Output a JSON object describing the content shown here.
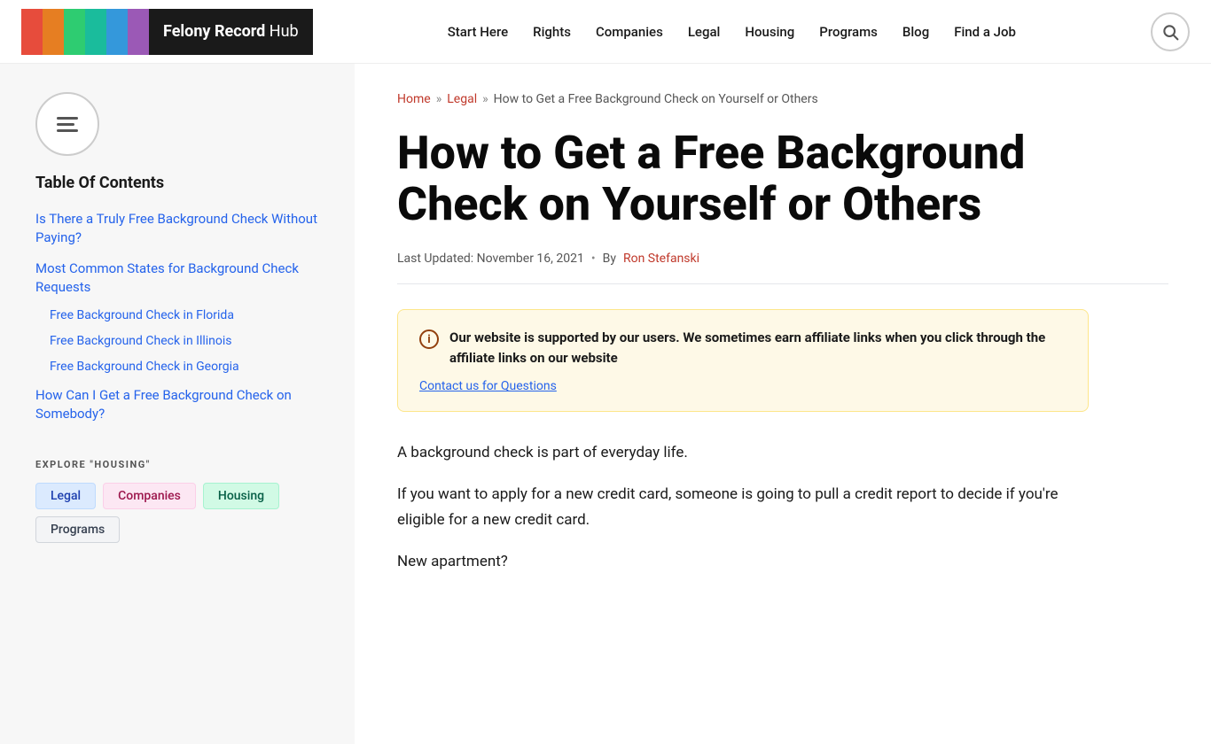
{
  "header": {
    "logo_text_bold": "Felony Record",
    "logo_text_normal": " Hub",
    "nav_items": [
      {
        "label": "Start Here",
        "href": "#"
      },
      {
        "label": "Rights",
        "href": "#"
      },
      {
        "label": "Companies",
        "href": "#"
      },
      {
        "label": "Legal",
        "href": "#"
      },
      {
        "label": "Housing",
        "href": "#"
      },
      {
        "label": "Programs",
        "href": "#"
      },
      {
        "label": "Blog",
        "href": "#"
      },
      {
        "label": "Find a Job",
        "href": "#"
      }
    ],
    "search_label": "🔍"
  },
  "sidebar": {
    "toc_title": "Table Of Contents",
    "toc_items": [
      {
        "label": "Is There a Truly Free Background Check Without Paying?",
        "href": "#",
        "sub_items": []
      },
      {
        "label": "Most Common States for Background Check Requests",
        "href": "#",
        "sub_items": [
          {
            "label": "Free Background Check in Florida",
            "href": "#"
          },
          {
            "label": "Free Background Check in Illinois",
            "href": "#"
          },
          {
            "label": "Free Background Check in Georgia",
            "href": "#"
          }
        ]
      },
      {
        "label": "How Can I Get a Free Background Check on Somebody?",
        "href": "#",
        "sub_items": []
      }
    ],
    "explore_title": "EXPLORE \"HOUSING\"",
    "explore_tags": [
      {
        "label": "Legal",
        "class": "tag-legal"
      },
      {
        "label": "Companies",
        "class": "tag-companies"
      },
      {
        "label": "Housing",
        "class": "tag-housing"
      },
      {
        "label": "Programs",
        "class": "tag-programs"
      }
    ]
  },
  "breadcrumb": {
    "home": "Home",
    "legal": "Legal",
    "current": "How to Get a Free Background Check on Yourself or Others"
  },
  "article": {
    "title": "How to Get a Free Background Check on Yourself or Others",
    "meta_date": "Last Updated: November 16, 2021",
    "meta_by": "By",
    "meta_author": "Ron Stefanski",
    "affiliate_bold": "Our website is supported by our users. We sometimes earn affiliate links when you click through the affiliate links on our website",
    "affiliate_link_text": "Contact us for Questions",
    "para1": "A background check is part of everyday life.",
    "para2": "If you want to apply for a new credit card, someone is going to pull a credit report to decide if you're eligible for a new credit card.",
    "para3": "New apartment?"
  },
  "logo_colors": [
    "#e74c3c",
    "#e67e22",
    "#2ecc71",
    "#1abc9c",
    "#3498db",
    "#9b59b6"
  ]
}
